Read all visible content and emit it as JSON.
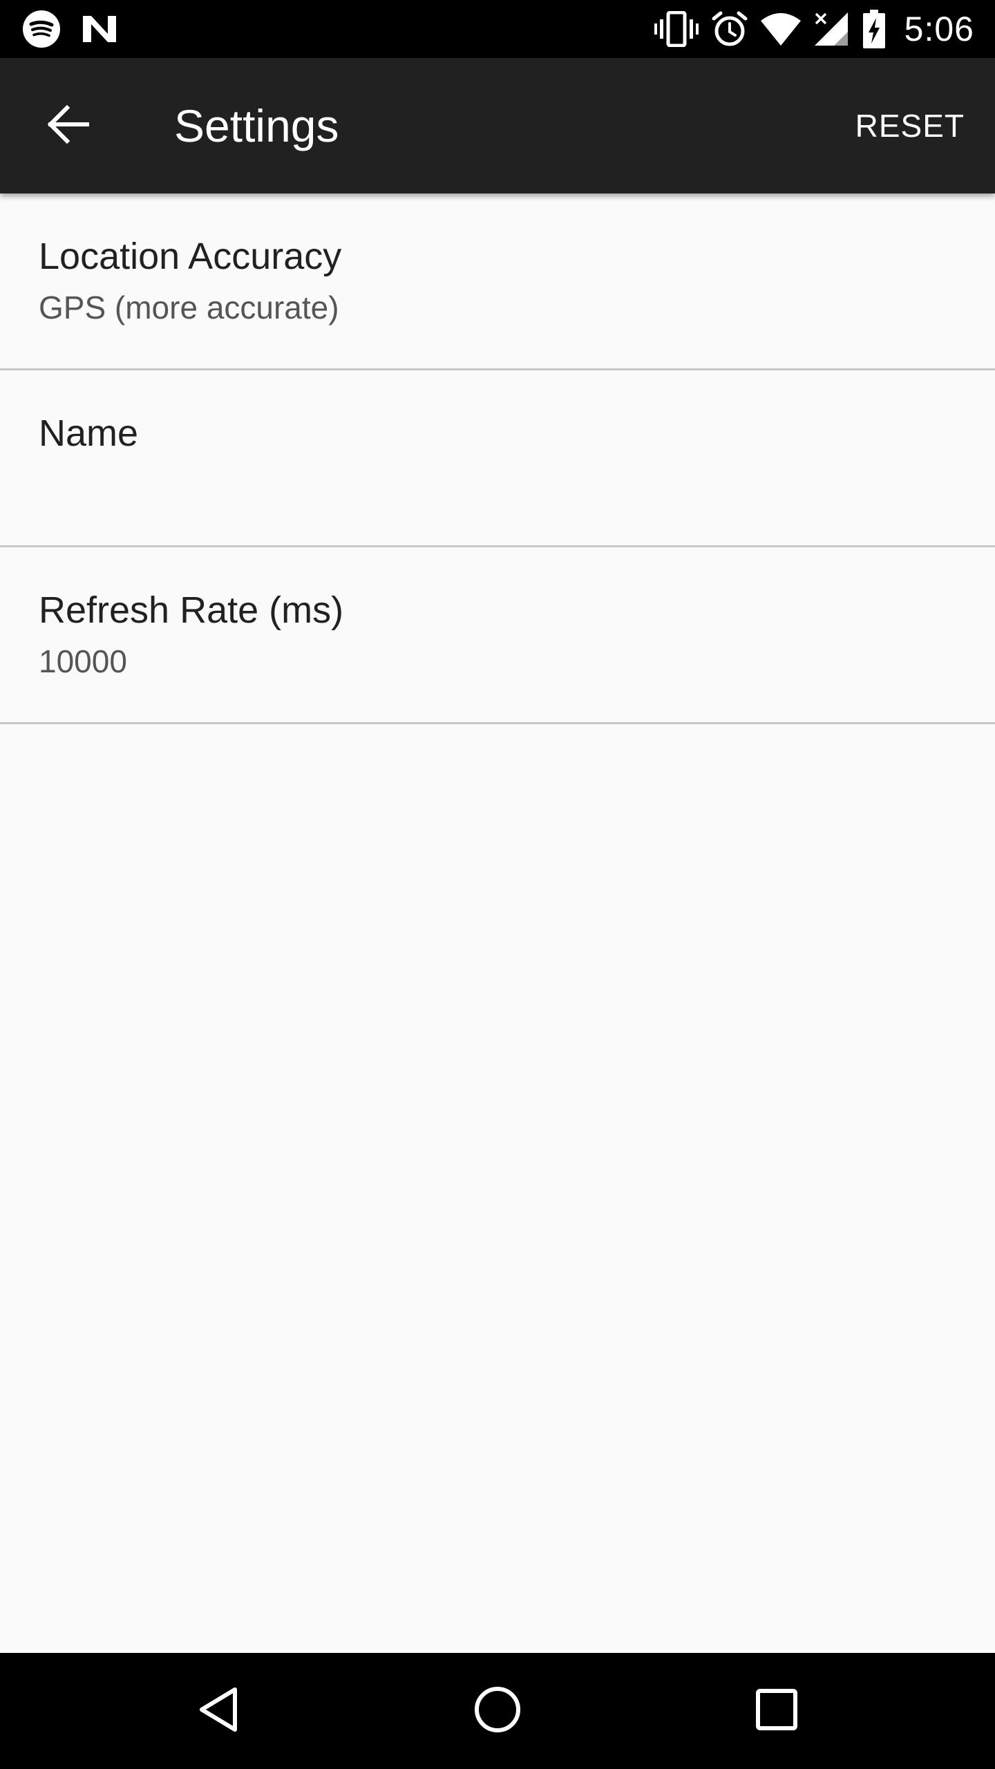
{
  "status_bar": {
    "time": "5:06",
    "left_icons": [
      "spotify-icon",
      "n-notification-icon"
    ],
    "right_icons": [
      "vibrate-icon",
      "alarm-icon",
      "wifi-icon",
      "signal-icon",
      "battery-charging-icon"
    ]
  },
  "app_bar": {
    "title": "Settings",
    "back_icon": "arrow-back-icon",
    "reset_label": "RESET",
    "background": "#212121"
  },
  "preferences": [
    {
      "title": "Location Accuracy",
      "summary": "GPS (more accurate)"
    },
    {
      "title": "Name",
      "summary": ""
    },
    {
      "title": "Refresh Rate (ms)",
      "summary": "10000"
    }
  ],
  "nav_bar": {
    "buttons": [
      "back-triangle-icon",
      "home-circle-icon",
      "recents-square-icon"
    ]
  }
}
